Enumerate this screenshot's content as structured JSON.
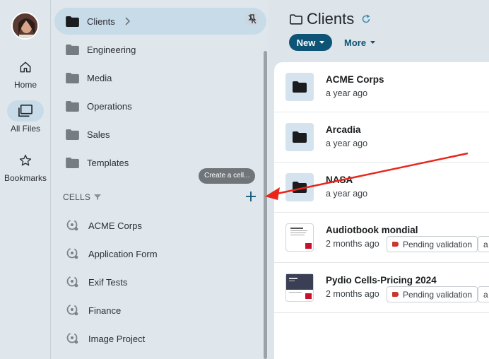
{
  "rail": {
    "items": [
      {
        "label": "Home",
        "icon": "home-icon"
      },
      {
        "label": "All Files",
        "icon": "folders-icon"
      },
      {
        "label": "Bookmarks",
        "icon": "star-icon"
      }
    ]
  },
  "tree": {
    "workspace": "Clients",
    "folders": [
      "Engineering",
      "Media",
      "Operations",
      "Sales",
      "Templates"
    ],
    "cells_title": "CELLS",
    "tooltip": "Create a cell...",
    "cells": [
      "ACME Corps",
      "Application Form",
      "Exif Tests",
      "Finance",
      "Image Project"
    ]
  },
  "main": {
    "title": "Clients",
    "new_label": "New",
    "more_label": "More",
    "files": [
      {
        "name": "ACME Corps",
        "date": "a year ago",
        "kind": "folder"
      },
      {
        "name": "Arcadia",
        "date": "a year ago",
        "kind": "folder"
      },
      {
        "name": "NASA",
        "date": "a year ago",
        "kind": "folder"
      },
      {
        "name": "Audiotbook mondial",
        "date": "2 months ago",
        "kind": "pdf",
        "badge": "Pending validation",
        "badge2": "a"
      },
      {
        "name": "Pydio Cells-Pricing 2024",
        "date": "2 months ago",
        "kind": "pdf",
        "badge": "Pending validation",
        "badge2": "a"
      }
    ]
  },
  "colors": {
    "accent": "#0e5476",
    "annotation": "#e8261c",
    "tag": "#c8382e"
  }
}
